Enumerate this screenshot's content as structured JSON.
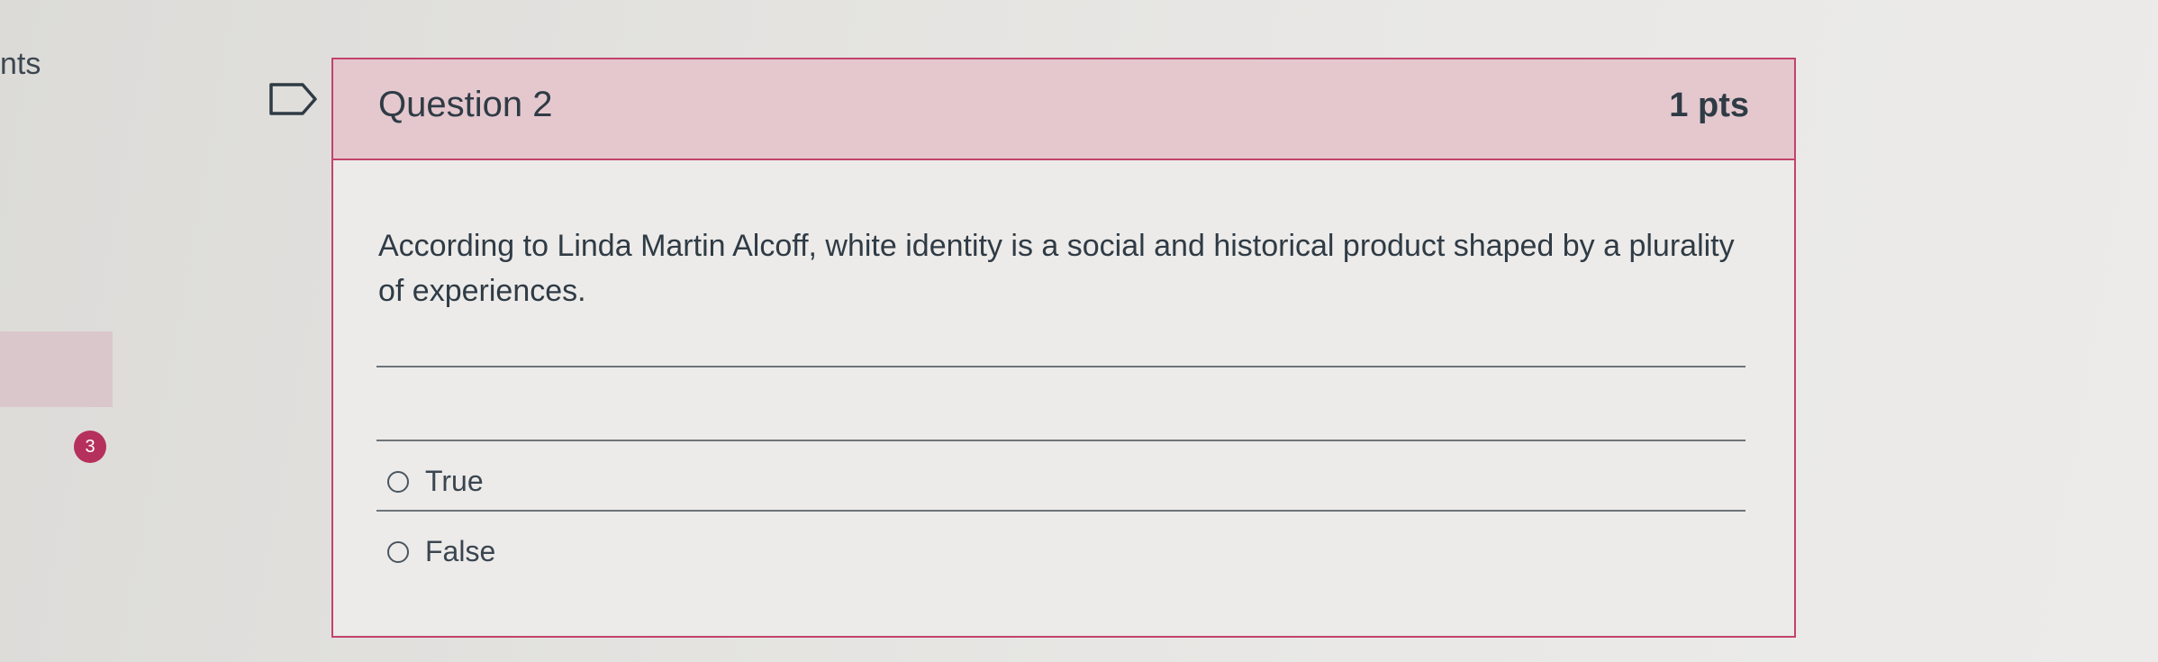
{
  "sidebar": {
    "heading_fragment": "nts",
    "question_number_badge": "3"
  },
  "question": {
    "title": "Question 2",
    "points": "1 pts",
    "text": "According to Linda Martin Alcoff, white identity is a social and historical product shaped by a plurality of experiences.",
    "answers": [
      {
        "label": "True",
        "selected": false
      },
      {
        "label": "False",
        "selected": false
      }
    ]
  },
  "colors": {
    "accent": "#c2436b",
    "header_background": "#e4c8ce",
    "badge": "#b5305c"
  },
  "icons": {
    "flag": "flag-question-icon"
  }
}
